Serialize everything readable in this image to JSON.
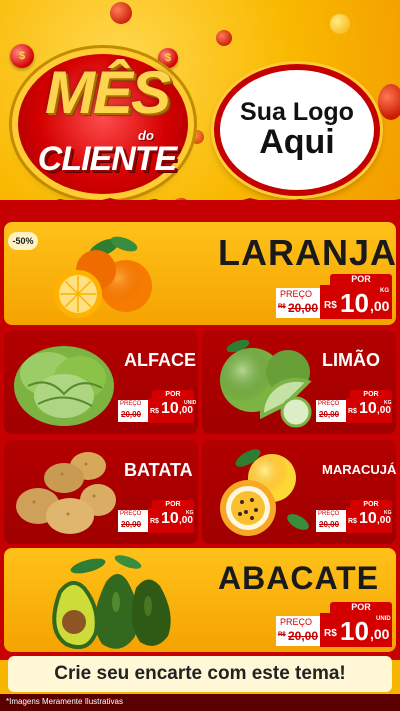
{
  "header": {
    "badge": {
      "line1": "MÊS",
      "line2": "do",
      "line3": "CLIENTE"
    },
    "logo": {
      "line1": "Sua Logo",
      "line2": "Aqui"
    },
    "coin_symbol": "$"
  },
  "colors": {
    "brand_red": "#c60000",
    "accent_yellow": "#f7b500",
    "tag_red": "#d40000"
  },
  "currency": "R$",
  "products": [
    {
      "name": "LARANJA",
      "discount": "-50%",
      "por_label": "POR",
      "preco_label": "PREÇO",
      "old_prefix": "R$",
      "old_price": "20,00",
      "price_int": "10",
      "price_dec": ",00",
      "unit": "KG",
      "icon": "orange-fruit-icon"
    },
    {
      "name": "ALFACE",
      "por_label": "POR",
      "preco_label": "PREÇO",
      "old_price": "20,00",
      "price_int": "10",
      "price_dec": ",00",
      "unit": "UNID",
      "icon": "lettuce-icon"
    },
    {
      "name": "LIMÃO",
      "por_label": "POR",
      "preco_label": "PREÇO",
      "old_price": "20,00",
      "price_int": "10",
      "price_dec": ",00",
      "unit": "KG",
      "icon": "lime-icon"
    },
    {
      "name": "BATATA",
      "por_label": "POR",
      "preco_label": "PREÇO",
      "old_price": "20,00",
      "price_int": "10",
      "price_dec": ",00",
      "unit": "KG",
      "icon": "potato-icon"
    },
    {
      "name": "MARACUJÁ",
      "por_label": "POR",
      "preco_label": "PREÇO",
      "old_price": "20,00",
      "price_int": "10",
      "price_dec": ",00",
      "unit": "KG",
      "icon": "passion-fruit-icon"
    },
    {
      "name": "ABACATE",
      "por_label": "POR",
      "preco_label": "PREÇO",
      "old_prefix": "R$",
      "old_price": "20,00",
      "price_int": "10",
      "price_dec": ",00",
      "unit": "UNID",
      "icon": "avocado-icon"
    }
  ],
  "cta": "Crie seu encarte com este tema!",
  "footer_note": "*Imagens Meramente Ilustrativas"
}
